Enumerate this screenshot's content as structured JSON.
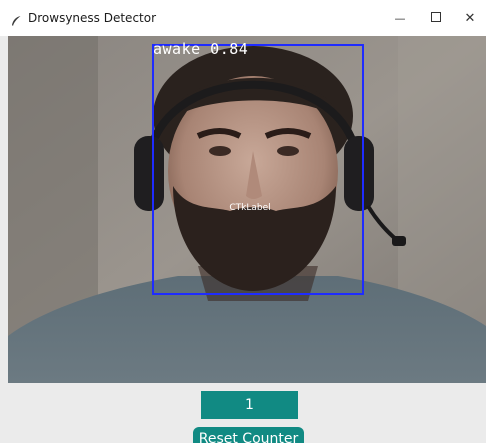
{
  "window": {
    "title": "Drowsyness Detector",
    "minimize_glyph": "—",
    "maximize_glyph": "☐",
    "close_glyph": "✕"
  },
  "detection": {
    "label": "awake 0.84",
    "box_color": "#1f2cff"
  },
  "overlay_label": "CTkLabel",
  "counter": {
    "value": "1",
    "color": "#118a83"
  },
  "reset_button": {
    "label": "Reset Counter"
  },
  "icons": {
    "app": "feather-icon",
    "minimize": "minimize-icon",
    "maximize": "maximize-icon",
    "close": "close-icon"
  }
}
